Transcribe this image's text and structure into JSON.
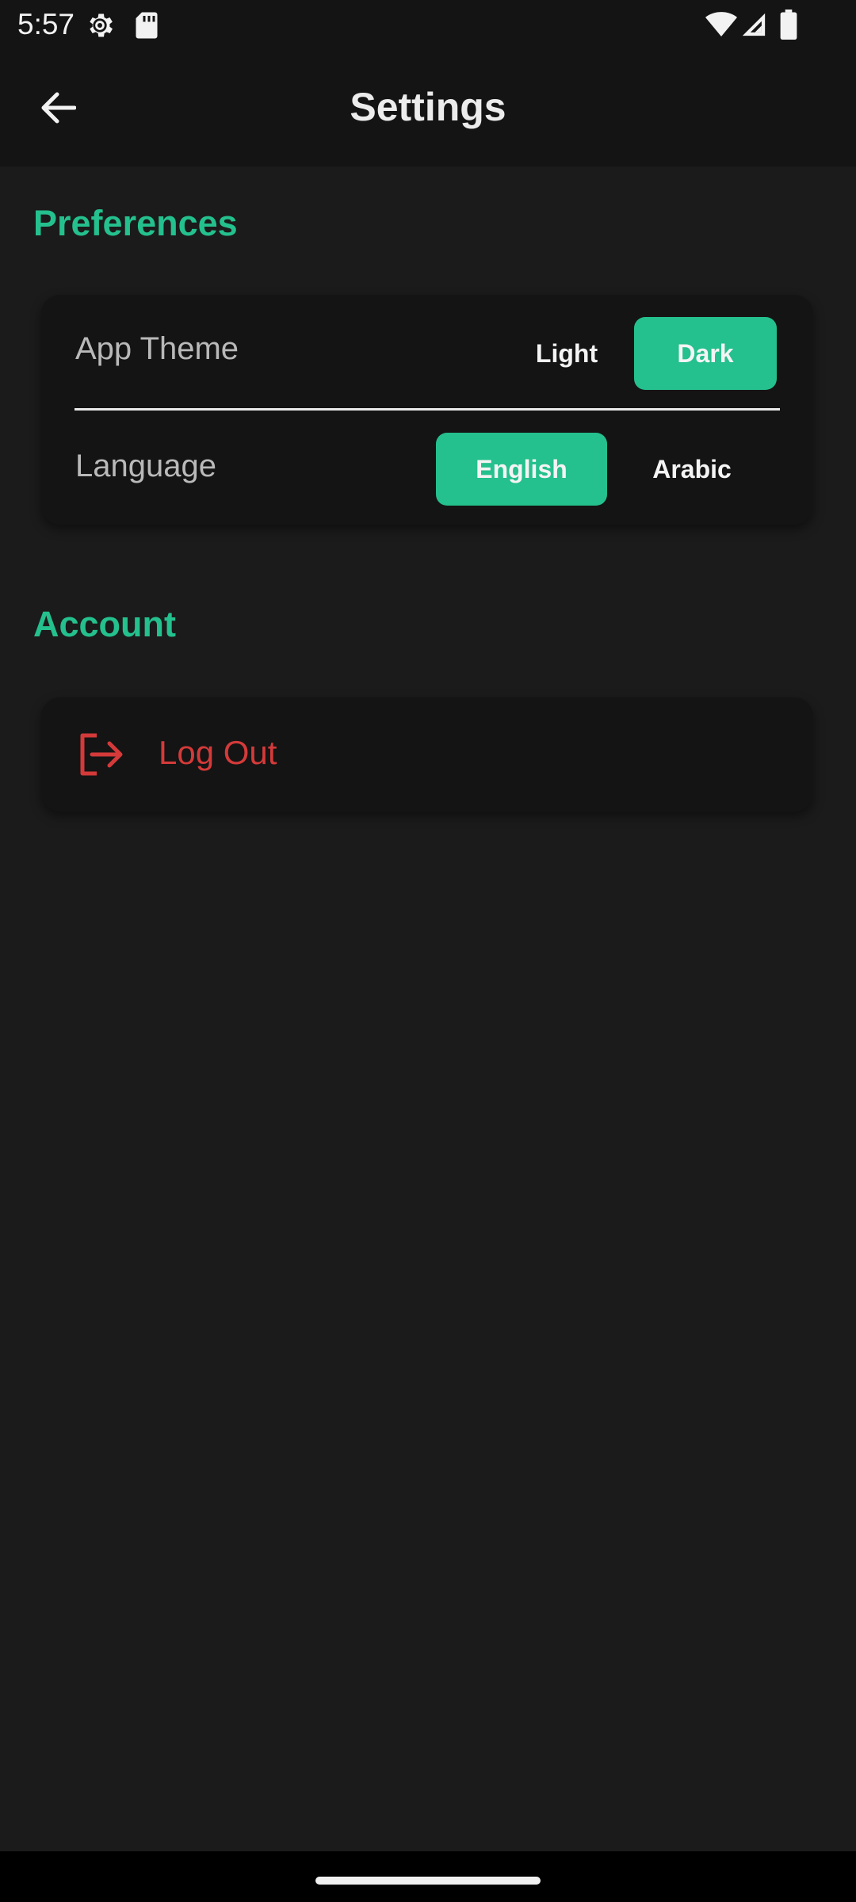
{
  "status_bar": {
    "time": "5:57",
    "left_icons": [
      "settings-gear-icon",
      "sd-card-icon"
    ],
    "right_icons": [
      "wifi-icon",
      "cellular-signal-icon",
      "battery-icon"
    ]
  },
  "app_bar": {
    "back_icon": "arrow-left-icon",
    "title": "Settings"
  },
  "preferences": {
    "title": "Preferences",
    "app_theme": {
      "label": "App Theme",
      "options": [
        "Light",
        "Dark"
      ],
      "selected": "Dark"
    },
    "language": {
      "label": "Language",
      "options": [
        "English",
        "Arabic"
      ],
      "selected": "English"
    }
  },
  "account": {
    "title": "Account",
    "logout": {
      "icon": "logout-icon",
      "label": "Log Out"
    }
  },
  "colors": {
    "accent": "#24c08d",
    "danger": "#d43a3a",
    "background": "#1b1b1b",
    "surface": "#141414"
  }
}
